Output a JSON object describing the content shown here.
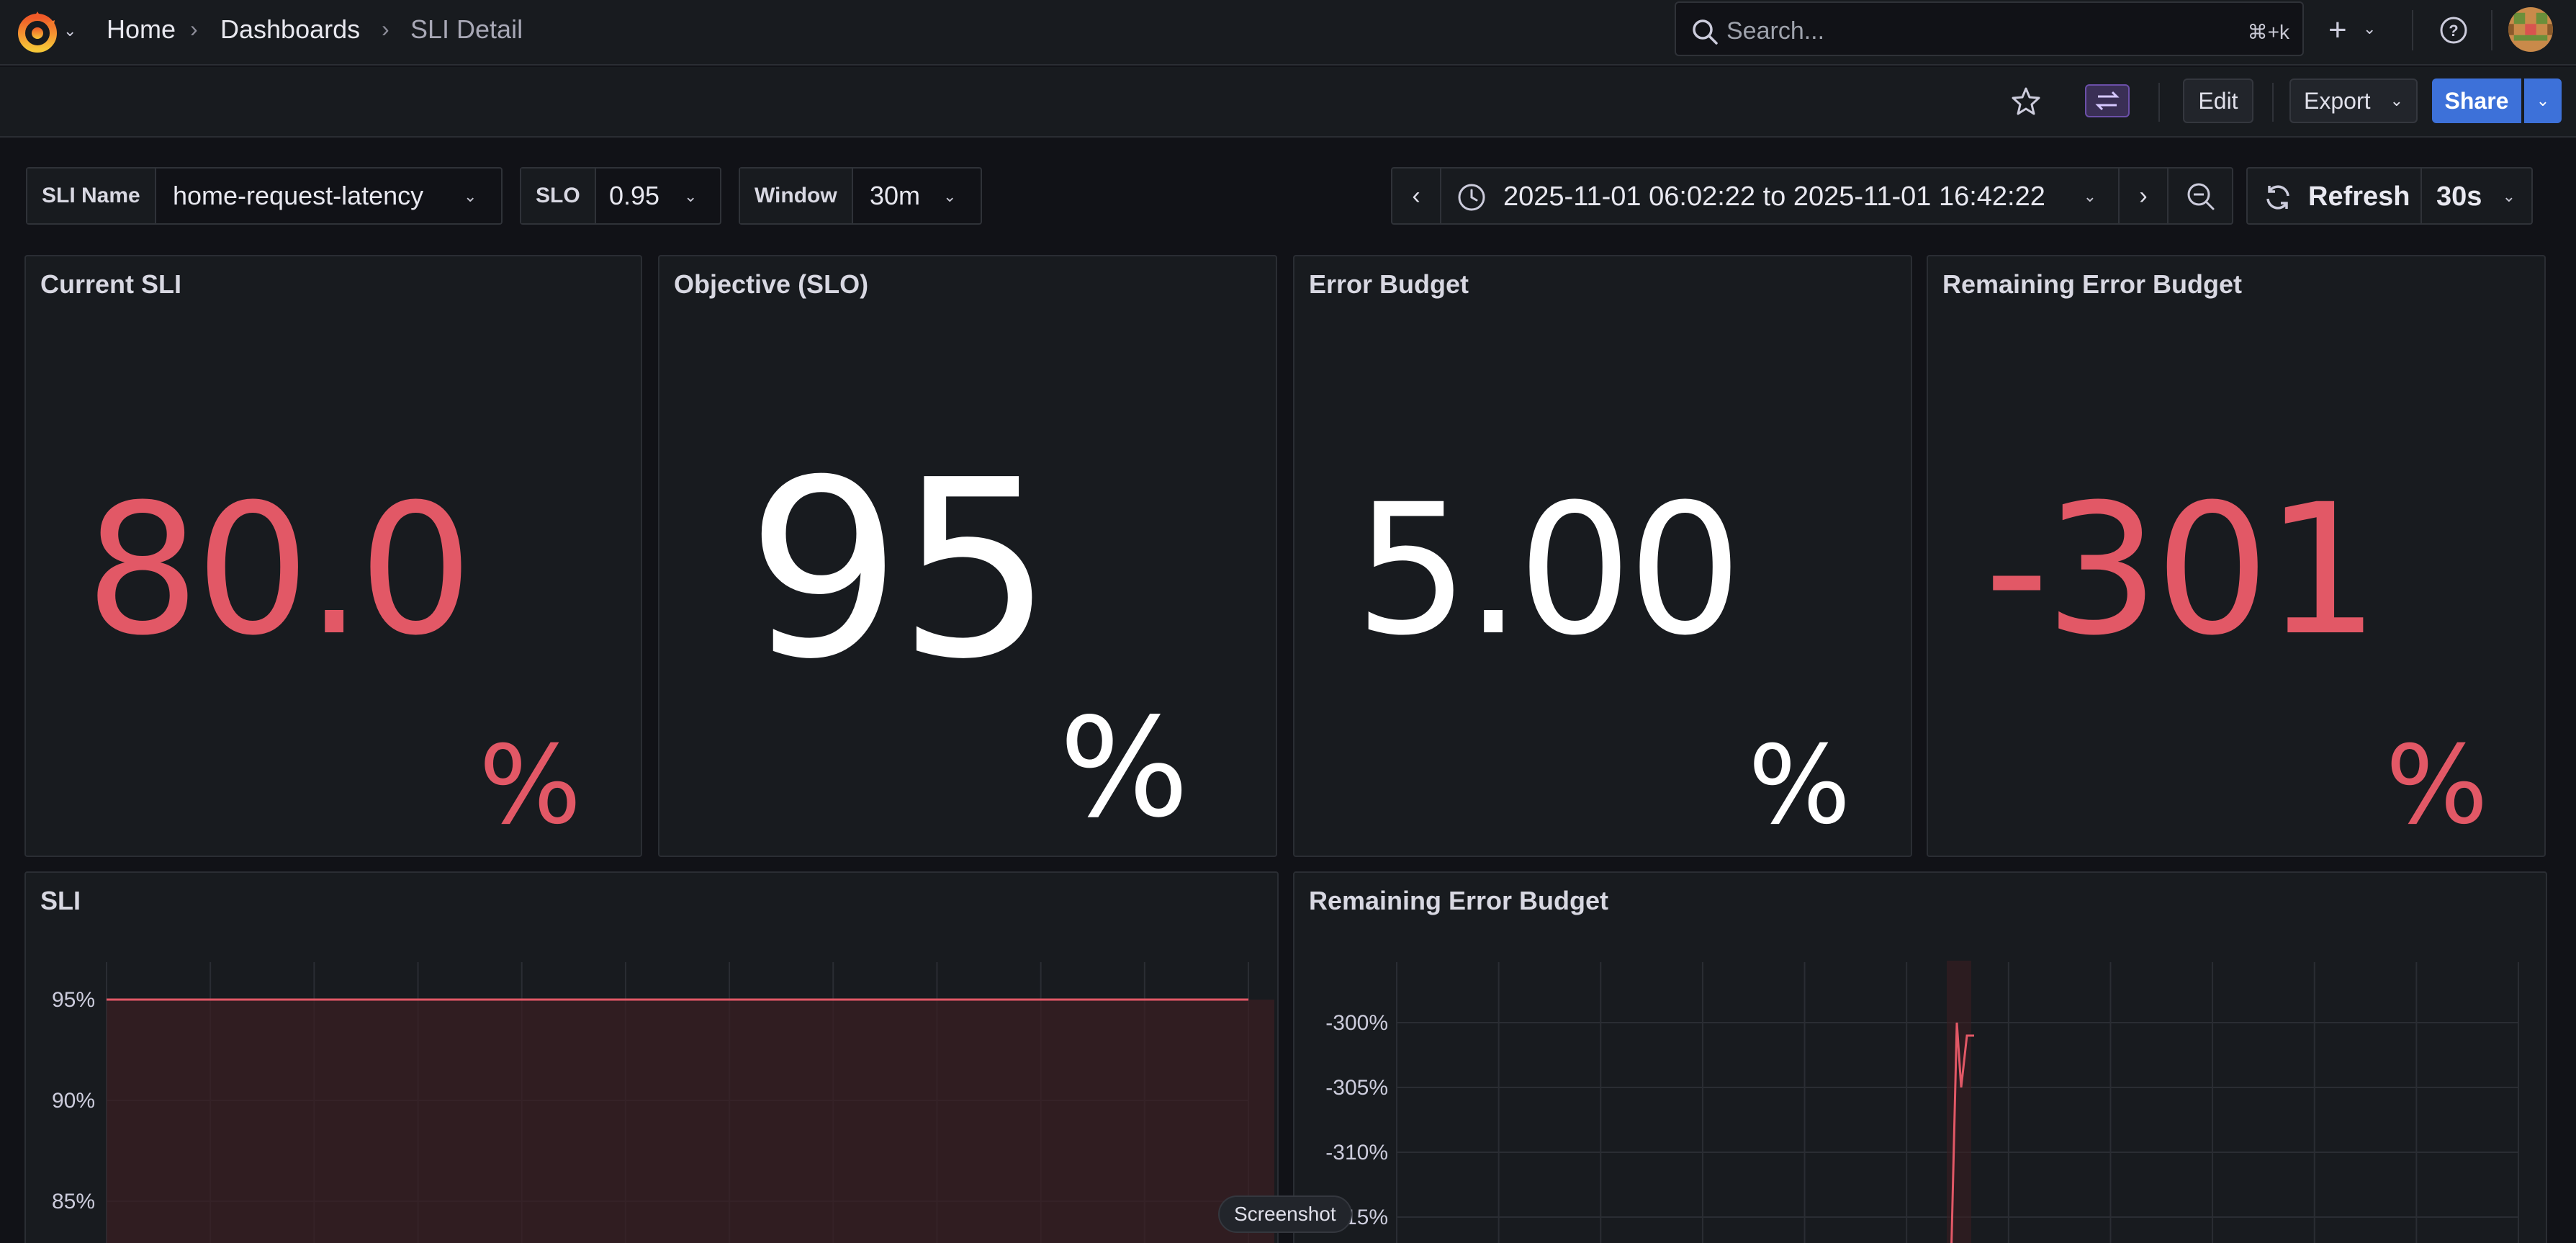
{
  "nav": {
    "breadcrumbs": [
      "Home",
      "Dashboards",
      "SLI Detail"
    ],
    "search_placeholder": "Search...",
    "search_shortcut": "⌘+k"
  },
  "toolbar": {
    "edit_label": "Edit",
    "export_label": "Export",
    "share_label": "Share"
  },
  "variables": [
    {
      "label": "SLI Name",
      "value": "home-request-latency"
    },
    {
      "label": "SLO",
      "value": "0.95"
    },
    {
      "label": "Window",
      "value": "30m"
    }
  ],
  "time_picker": {
    "range": "2025-11-01 06:02:22 to 2025-11-01 16:42:22",
    "refresh_label": "Refresh",
    "refresh_interval": "30s"
  },
  "panels": {
    "current_sli": {
      "title": "Current SLI",
      "value": "80.0",
      "unit": "%",
      "color": "#e25866"
    },
    "objective": {
      "title": "Objective (SLO)",
      "value": "95",
      "unit": "%",
      "color": "#ffffff"
    },
    "error_budget": {
      "title": "Error Budget",
      "value": "5.00",
      "unit": "%",
      "color": "#ffffff"
    },
    "remaining_budget": {
      "title": "Remaining Error Budget",
      "value": "-301",
      "unit": "%",
      "color": "#e25866"
    },
    "sli_chart": {
      "title": "SLI"
    },
    "remaining_chart": {
      "title": "Remaining Error Budget"
    }
  },
  "tooltip": "Screenshot",
  "chart_data": [
    {
      "type": "line",
      "title": "SLI",
      "y_ticks": [
        "95%",
        "90%",
        "85%"
      ],
      "series": [
        {
          "values": [
            95,
            95,
            95,
            95,
            95,
            95,
            95,
            95,
            95,
            95,
            95,
            95
          ]
        }
      ],
      "fill": "area below threshold",
      "color": "#e25866",
      "grid": true
    },
    {
      "type": "line",
      "title": "Remaining Error Budget",
      "y_ticks": [
        "-300%",
        "-305%",
        "-310%",
        "-315%"
      ],
      "series": [
        {
          "values": [
            -330,
            -300,
            -305,
            -303,
            -301,
            -301
          ]
        }
      ],
      "color": "#e25866",
      "grid": true
    }
  ]
}
